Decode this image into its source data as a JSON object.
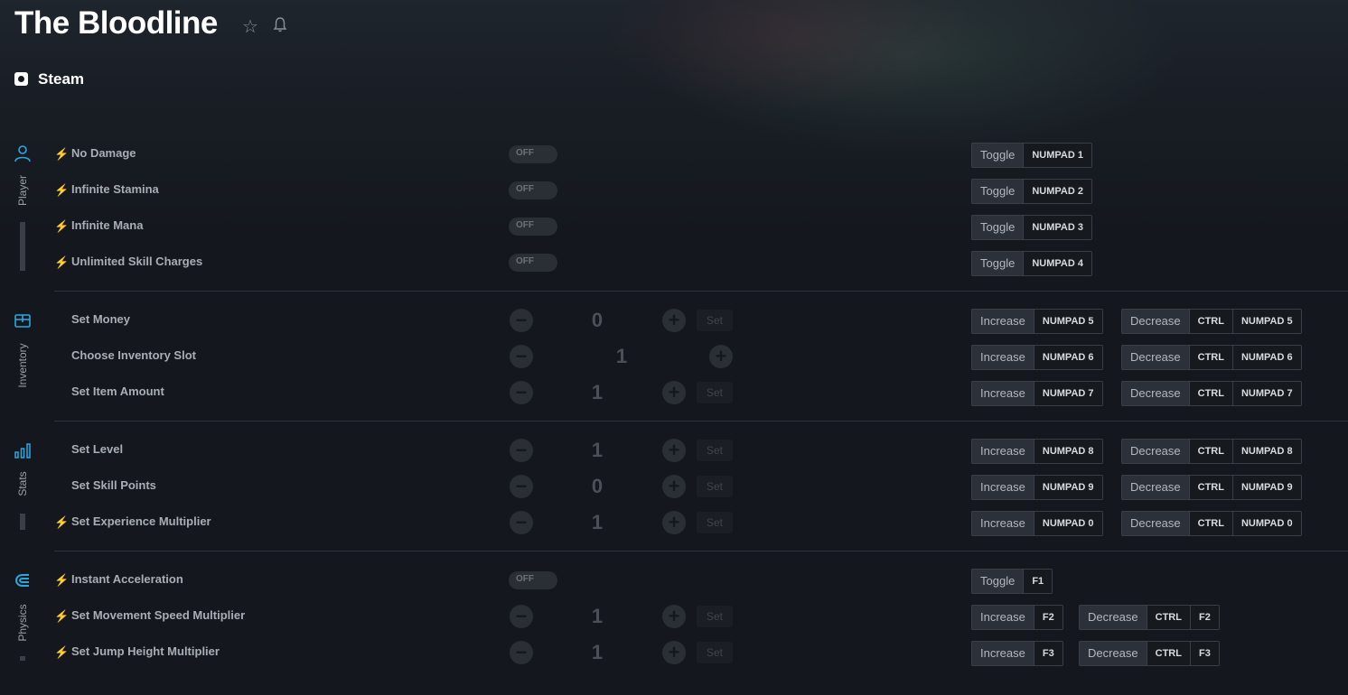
{
  "game": {
    "title": "The Bloodline",
    "platform": "Steam"
  },
  "categories": [
    {
      "label": "Player"
    },
    {
      "label": "Inventory"
    },
    {
      "label": "Stats"
    },
    {
      "label": "Physics"
    }
  ],
  "cheats": [
    {
      "name": "No Damage",
      "state": "OFF",
      "action": "Toggle",
      "key": "NUMPAD 1"
    },
    {
      "name": "Infinite Stamina",
      "state": "OFF",
      "action": "Toggle",
      "key": "NUMPAD 2"
    },
    {
      "name": "Infinite Mana",
      "state": "OFF",
      "action": "Toggle",
      "key": "NUMPAD 3"
    },
    {
      "name": "Unlimited Skill Charges",
      "state": "OFF",
      "action": "Toggle",
      "key": "NUMPAD 4"
    },
    {
      "name": "Set Money",
      "value": "0",
      "set": "Set",
      "inc": "Increase",
      "inc_key": "NUMPAD 5",
      "dec": "Decrease",
      "dec_mod": "CTRL",
      "dec_key": "NUMPAD 5"
    },
    {
      "name": "Choose Inventory Slot",
      "value": "1",
      "inc": "Increase",
      "inc_key": "NUMPAD 6",
      "dec": "Decrease",
      "dec_mod": "CTRL",
      "dec_key": "NUMPAD 6"
    },
    {
      "name": "Set Item Amount",
      "value": "1",
      "set": "Set",
      "inc": "Increase",
      "inc_key": "NUMPAD 7",
      "dec": "Decrease",
      "dec_mod": "CTRL",
      "dec_key": "NUMPAD 7"
    },
    {
      "name": "Set Level",
      "value": "1",
      "set": "Set",
      "inc": "Increase",
      "inc_key": "NUMPAD 8",
      "dec": "Decrease",
      "dec_mod": "CTRL",
      "dec_key": "NUMPAD 8"
    },
    {
      "name": "Set Skill Points",
      "value": "0",
      "set": "Set",
      "inc": "Increase",
      "inc_key": "NUMPAD 9",
      "dec": "Decrease",
      "dec_mod": "CTRL",
      "dec_key": "NUMPAD 9"
    },
    {
      "name": "Set Experience Multiplier",
      "value": "1",
      "set": "Set",
      "inc": "Increase",
      "inc_key": "NUMPAD 0",
      "dec": "Decrease",
      "dec_mod": "CTRL",
      "dec_key": "NUMPAD 0"
    },
    {
      "name": "Instant Acceleration",
      "state": "OFF",
      "action": "Toggle",
      "key": "F1"
    },
    {
      "name": "Set Movement Speed Multiplier",
      "value": "1",
      "set": "Set",
      "inc": "Increase",
      "inc_key": "F2",
      "dec": "Decrease",
      "dec_mod": "CTRL",
      "dec_key": "F2"
    },
    {
      "name": "Set Jump Height Multiplier",
      "value": "1",
      "set": "Set",
      "inc": "Increase",
      "inc_key": "F3",
      "dec": "Decrease",
      "dec_mod": "CTRL",
      "dec_key": "F3"
    }
  ],
  "symbols": {
    "minus": "−",
    "plus": "+",
    "bolt": "⚡",
    "star": "☆"
  },
  "colors": {
    "accent": "#29a8e0",
    "background": "#14181e"
  }
}
